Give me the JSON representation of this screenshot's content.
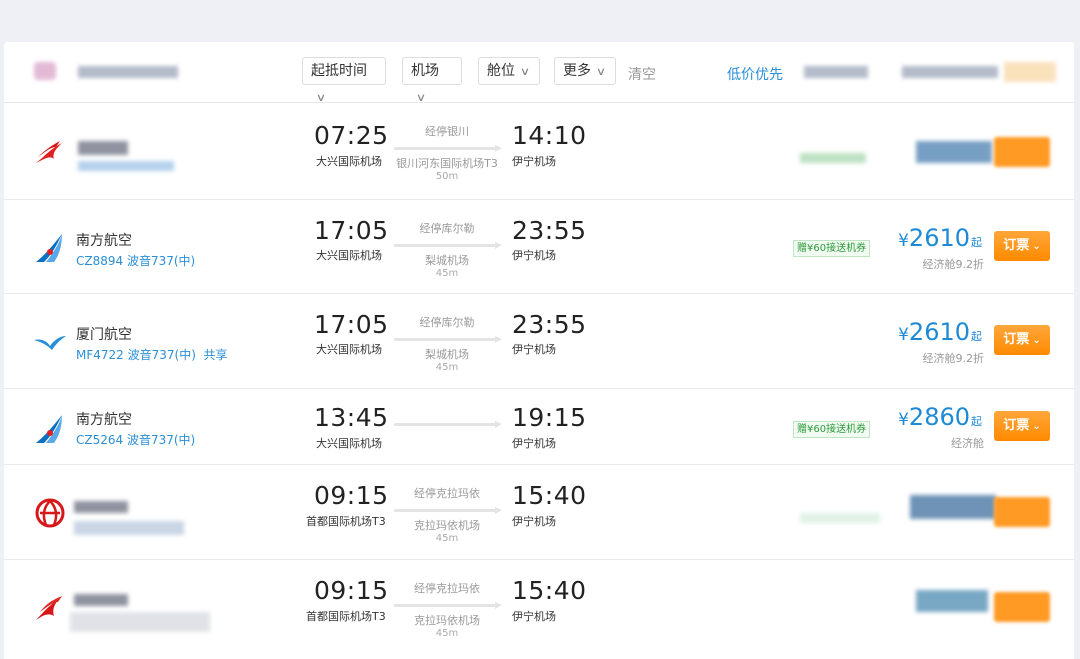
{
  "filters": {
    "departure_time": "起抵时间",
    "airport": "机场",
    "cabin": "舱位",
    "more": "更多",
    "clear": "清空",
    "sort_low_price": "低价优先"
  },
  "flights": [
    {
      "airline": "",
      "flight": "",
      "dep_time": "07:25",
      "dep_airport": "大兴国际机场",
      "stop_label": "经停银川",
      "stop_airport": "银川河东国际机场T3",
      "stop_duration": "50m",
      "arr_time": "14:10",
      "arr_airport": "伊宁机场"
    },
    {
      "airline": "南方航空",
      "flight": "CZ8894 波音737(中)",
      "dep_time": "17:05",
      "dep_airport": "大兴国际机场",
      "stop_label": "经停库尔勒",
      "stop_airport": "梨城机场",
      "stop_duration": "45m",
      "arr_time": "23:55",
      "arr_airport": "伊宁机场",
      "promo": "赠¥60接送机券",
      "price_currency": "¥",
      "price": "2610",
      "price_suffix": "起",
      "cabin": "经济舱9.2折",
      "book": "订票"
    },
    {
      "airline": "厦门航空",
      "flight": "MF4722 波音737(中)",
      "share": "共享",
      "dep_time": "17:05",
      "dep_airport": "大兴国际机场",
      "stop_label": "经停库尔勒",
      "stop_airport": "梨城机场",
      "stop_duration": "45m",
      "arr_time": "23:55",
      "arr_airport": "伊宁机场",
      "price_currency": "¥",
      "price": "2610",
      "price_suffix": "起",
      "cabin": "经济舱9.2折",
      "book": "订票"
    },
    {
      "airline": "南方航空",
      "flight": "CZ5264 波音737(中)",
      "dep_time": "13:45",
      "dep_airport": "大兴国际机场",
      "arr_time": "19:15",
      "arr_airport": "伊宁机场",
      "promo": "赠¥60接送机券",
      "price_currency": "¥",
      "price": "2860",
      "price_suffix": "起",
      "cabin": "经济舱",
      "book": "订票"
    },
    {
      "airline": "",
      "flight": "",
      "dep_time": "09:15",
      "dep_airport": "首都国际机场T3",
      "stop_label": "经停克拉玛依",
      "stop_airport": "克拉玛依机场",
      "stop_duration": "45m",
      "arr_time": "15:40",
      "arr_airport": "伊宁机场"
    },
    {
      "airline": "",
      "flight": "",
      "dep_time": "09:15",
      "dep_airport": "首都国际机场T3",
      "stop_label": "经停克拉玛依",
      "stop_airport": "克拉玛依机场",
      "stop_duration": "45m",
      "arr_time": "15:40",
      "arr_airport": "伊宁机场"
    }
  ],
  "colors": {
    "accent_blue": "#1e8ad6",
    "book_orange": "#ff8a00",
    "promo_green": "#2b9a3a"
  },
  "icons": {
    "chevron": "chevron-down-icon",
    "logos": [
      "shenzhen-airlines-logo",
      "china-southern-logo",
      "xiamen-airlines-logo",
      "china-southern-logo",
      "air-china-logo",
      "shenzhen-airlines-logo"
    ]
  }
}
